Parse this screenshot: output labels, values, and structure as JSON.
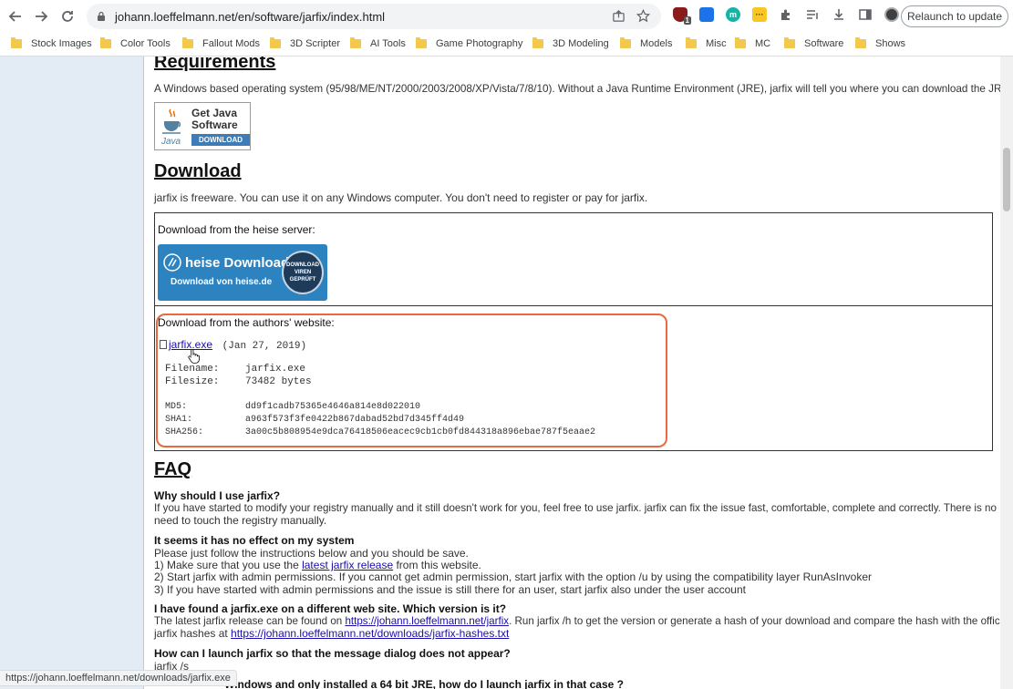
{
  "browser": {
    "url": "johann.loeffelmann.net/en/software/jarfix/index.html",
    "relaunch_label": "Relaunch to update",
    "extension_badge": "1"
  },
  "bookmarks": [
    "Stock Images",
    "Color Tools",
    "Fallout Mods",
    "3D Scripter",
    "AI Tools",
    "Game Photography",
    "3D Modeling",
    "Models",
    "Misc",
    "MC",
    "Software",
    "Shows"
  ],
  "requirements": {
    "heading": "Requirements",
    "text": "A Windows based operating system (95/98/ME/NT/2000/2003/2008/XP/Vista/7/8/10). Without a Java Runtime Environment (JRE), jarfix will tell you where you can download the JRE.",
    "java_line1": "Get Java",
    "java_line2": "Software",
    "java_download": "DOWNLOAD"
  },
  "download": {
    "heading": "Download",
    "text": "jarfix is freeware. You can use it on any Windows computer. You don't need to register or pay for jarfix.",
    "heise_label": "Download from the heise server:",
    "heise_title": "heise Download",
    "heise_sub": "Download von heise.de",
    "heise_badge": "DOWNLOAD VIREN GEPRÜFT",
    "author_label": "Download from the authors' website:",
    "file_link": "jarfix.exe",
    "file_date": "(Jan 27, 2019)",
    "rows": [
      {
        "key": "Filename:",
        "value": "jarfix.exe"
      },
      {
        "key": "Filesize:",
        "value": "73482 bytes"
      },
      {
        "key": "MD5:",
        "value": "dd9f1cadb75365e4646a814e8d022010"
      },
      {
        "key": "SHA1:",
        "value": "a963f573f3fe0422b867dabad52bd7d345ff4d49"
      },
      {
        "key": "SHA256:",
        "value": "3a00c5b808954e9dca76418506eacec9cb1cb0fd844318a896ebae787f5eaae2"
      }
    ]
  },
  "faq": {
    "heading": "FAQ",
    "q1": "Why should I use jarfix?",
    "a1_l1": "If you have started to modify your registry manually and it still doesn't work for you, feel free to use jarfix. jarfix can fix the issue fast, comfortable, complete and correctly. There is no",
    "a1_l2": "need to touch the registry manually.",
    "q2": "It seems it has no effect on my system",
    "a2_l1": "Please just follow the instructions below and you should be save.",
    "a2_l2_pre": "1) Make sure that you use the ",
    "a2_l2_link": "latest jarfix release",
    "a2_l2_post": " from this website.",
    "a2_l3": "2) Start jarfix with admin permissions. If you cannot get admin permission, start jarfix with the option /u by using the compatibility layer RunAsInvoker",
    "a2_l4": "3) If you have started with admin permissions and the issue is still there for an user, start jarfix also under the user account",
    "q3": "I have found a jarfix.exe on a different web site. Which version is it?",
    "a3_l1_pre": "The latest jarfix release can be found on ",
    "a3_l1_link": "https://johann.loeffelmann.net/jarfix",
    "a3_l1_post": ". Run jarfix /h to get the version or generate a hash of your download and compare the hash with the official",
    "a3_l2_pre": "jarfix hashes at ",
    "a3_l2_link": "https://johann.loeffelmann.net/downloads/jarfix-hashes.txt",
    "q4": "How can I launch jarfix so that the message dialog does not appear?",
    "a4": "jarfix /s",
    "q5_partial": "Windows and only installed a 64 bit JRE, how do I launch jarfix in that case ?"
  },
  "status_url": "https://johann.loeffelmann.net/downloads/jarfix.exe"
}
